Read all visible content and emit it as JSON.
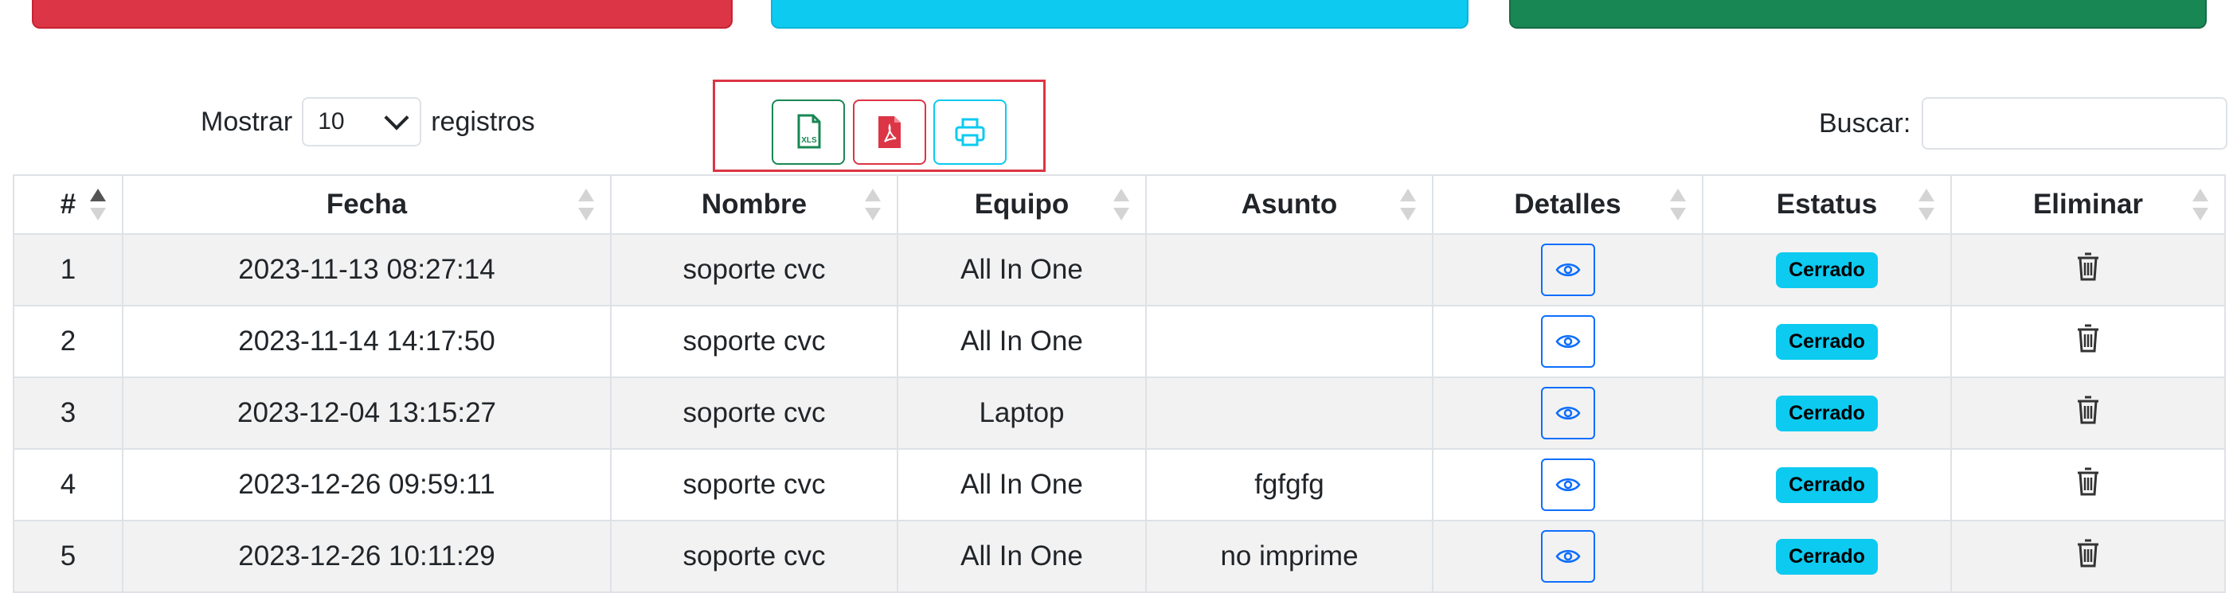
{
  "top_buttons": {
    "colors": [
      "#dc3545",
      "#0dcaf0",
      "#198754"
    ]
  },
  "length": {
    "label_before": "Mostrar",
    "value": "10",
    "label_after": "registros"
  },
  "export_buttons": {
    "excel_icon": "excel-file-icon",
    "excel_text": "XLS",
    "pdf_icon": "pdf-file-icon",
    "print_icon": "printer-icon"
  },
  "search": {
    "label": "Buscar:",
    "value": ""
  },
  "table": {
    "headers": [
      "#",
      "Fecha",
      "Nombre",
      "Equipo",
      "Asunto",
      "Detalles",
      "Estatus",
      "Eliminar"
    ],
    "rows": [
      {
        "num": "1",
        "fecha": "2023-11-13 08:27:14",
        "nombre": "soporte cvc",
        "equipo": "All In One",
        "asunto": "",
        "estatus": "Cerrado"
      },
      {
        "num": "2",
        "fecha": "2023-11-14 14:17:50",
        "nombre": "soporte cvc",
        "equipo": "All In One",
        "asunto": "",
        "estatus": "Cerrado"
      },
      {
        "num": "3",
        "fecha": "2023-12-04 13:15:27",
        "nombre": "soporte cvc",
        "equipo": "Laptop",
        "asunto": "",
        "estatus": "Cerrado"
      },
      {
        "num": "4",
        "fecha": "2023-12-26 09:59:11",
        "nombre": "soporte cvc",
        "equipo": "All In One",
        "asunto": "fgfgfg",
        "estatus": "Cerrado"
      },
      {
        "num": "5",
        "fecha": "2023-12-26 10:11:29",
        "nombre": "soporte cvc",
        "equipo": "All In One",
        "asunto": "no imprime",
        "estatus": "Cerrado"
      }
    ]
  },
  "colors": {
    "primary": "#0d6efd",
    "info": "#0dcaf0",
    "danger": "#dc3545",
    "success": "#198754"
  }
}
